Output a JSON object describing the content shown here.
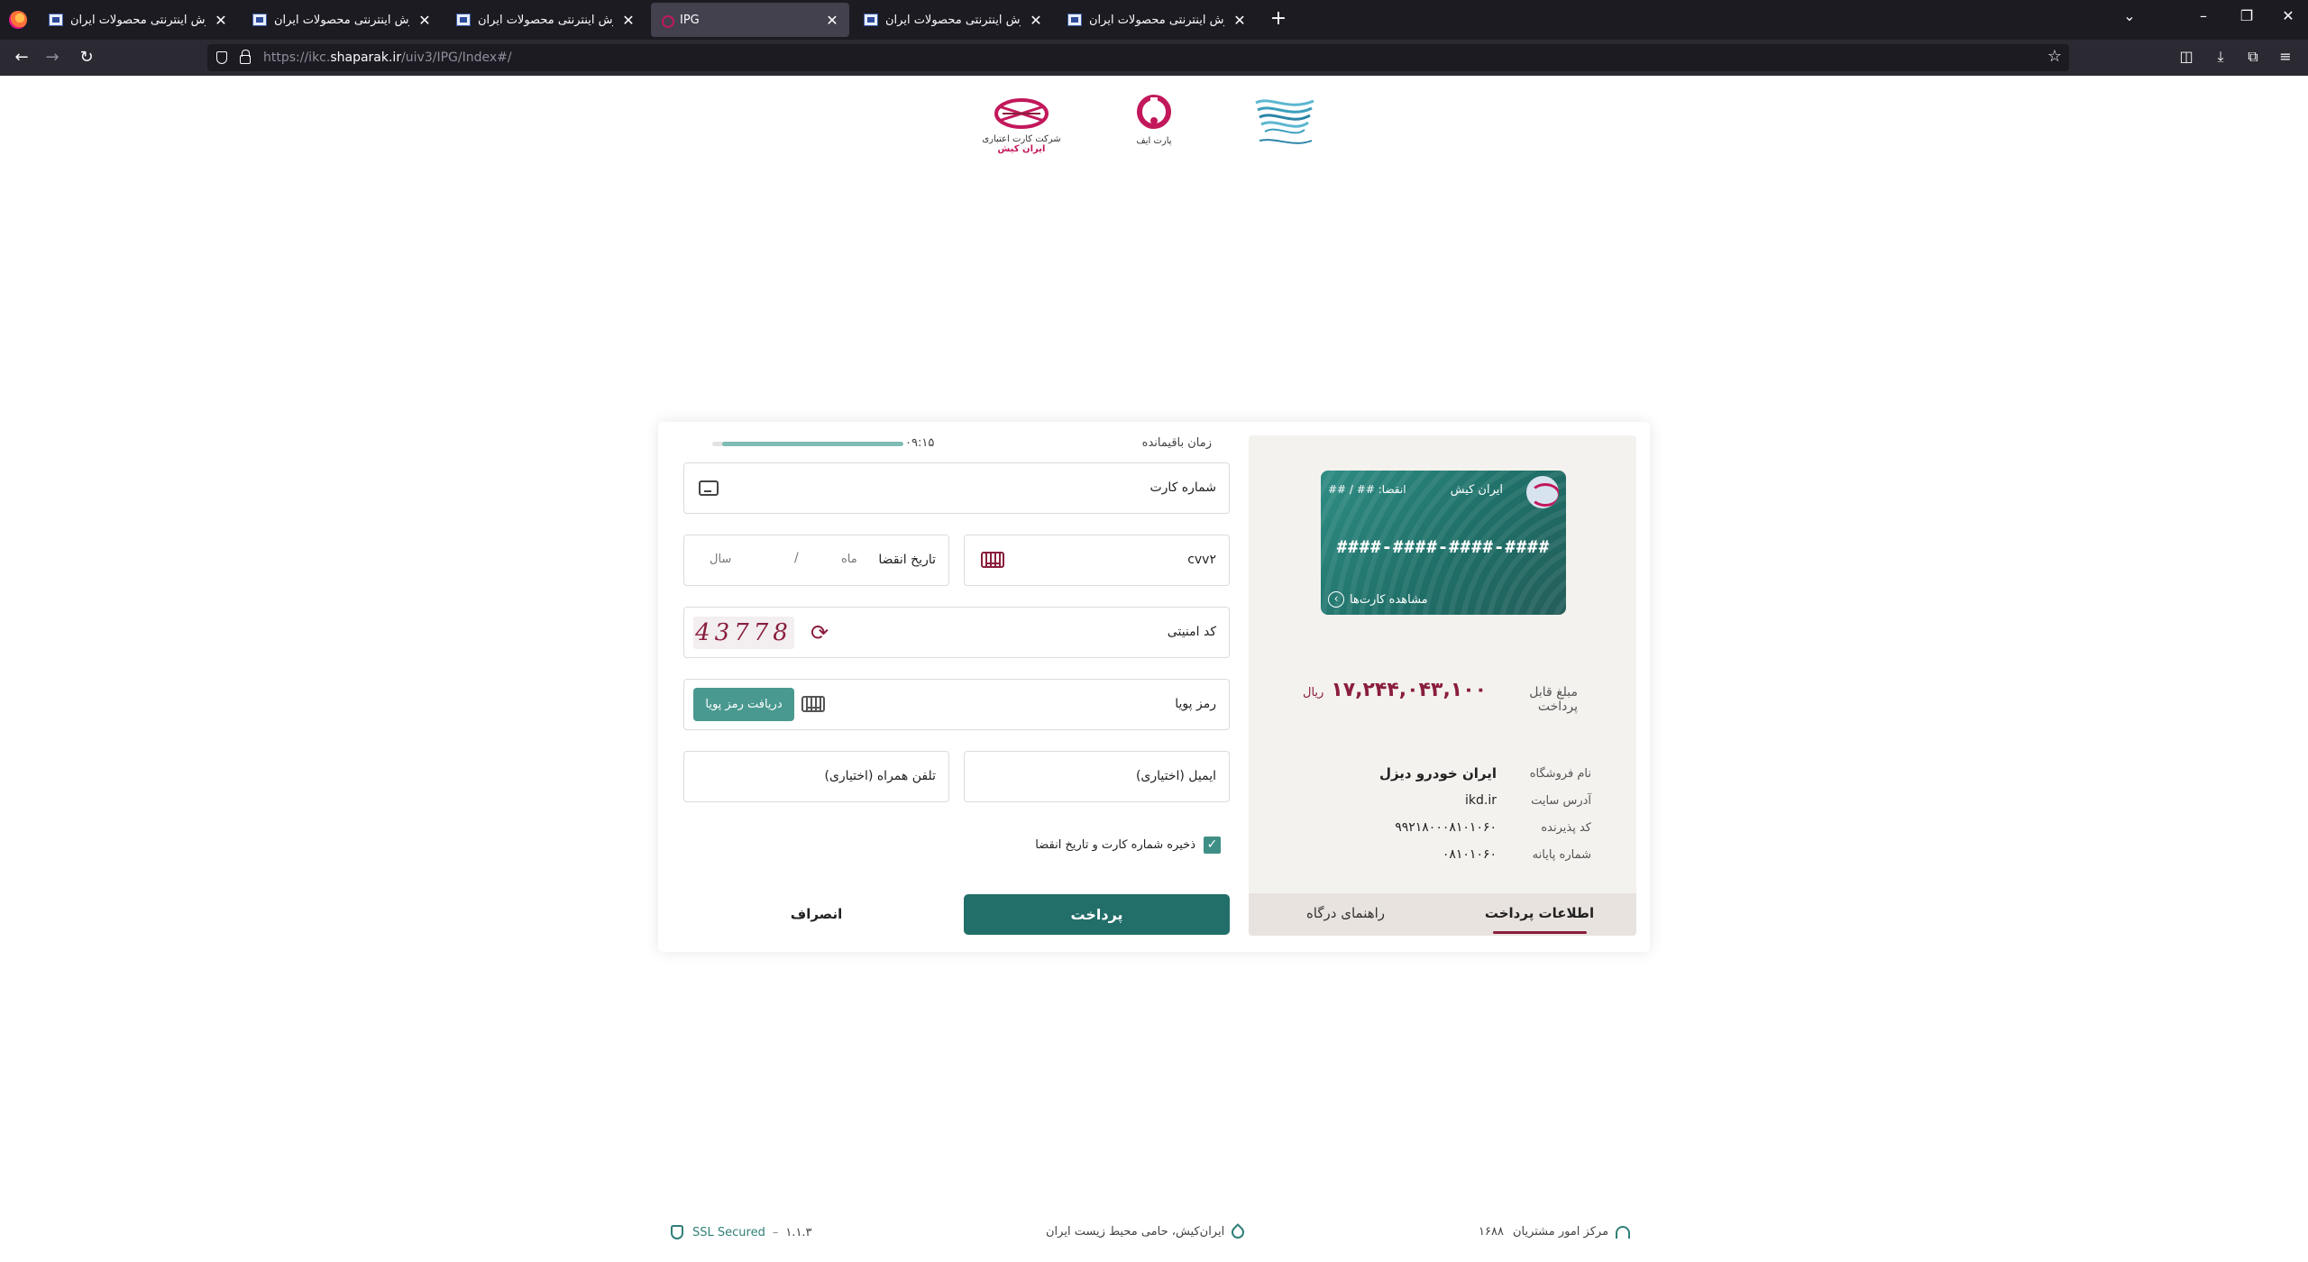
{
  "browser": {
    "tabs": [
      {
        "title": "فروش اینترنتی محصولات ایران -",
        "active": false
      },
      {
        "title": "فروش اینترنتی محصولات ایران -",
        "active": false
      },
      {
        "title": "فروش اینترنتی محصولات ایران -",
        "active": false
      },
      {
        "title": "IPG",
        "active": true
      },
      {
        "title": "فروش اینترنتی محصولات ایران -",
        "active": false
      },
      {
        "title": "فروش اینترنتی محصولات ایران -",
        "active": false
      }
    ],
    "url_prefix": "https://ikc.",
    "url_domain": "shaparak.ir",
    "url_path": "/uiv3/IPG/Index#/"
  },
  "logos": {
    "shaparak": "شاپرک",
    "parsian": "پارت ایف",
    "ikc_line1": "شرکت کارت اعتباری",
    "ikc_line2": "ایران کیش"
  },
  "form": {
    "timer_label": "زمان باقیمانده",
    "timer_value": "۰۹:۱۵",
    "timer_progress": 0.95,
    "card_number_label": "شماره کارت",
    "cvv_label": "cvv۲",
    "expiry_label": "تاریخ انقضا",
    "expiry_month": "ماه",
    "expiry_sep": "/",
    "expiry_year": "سال",
    "captcha_label": "کد امنیتی",
    "captcha_value": "43778",
    "otp_label": "رمز پویا",
    "otp_button": "دریافت رمز پویا",
    "email_label": "ایمیل (اختیاری)",
    "phone_label": "تلفن همراه (اختیاری)",
    "save_label": "ذخیره شماره کارت و تاریخ انقضا",
    "save_checked": true,
    "pay_button": "پرداخت",
    "cancel_button": "انصراف"
  },
  "card": {
    "bank": "ایران کیش",
    "expiry": "انقضا: ## / ##",
    "number": "####-####-####-####",
    "view_cards": "مشاهده کارت‌ها"
  },
  "payment": {
    "amount_label": "مبلغ قابل پرداخت",
    "amount": "۱۷,۲۴۴,۰۴۳,۱۰۰",
    "currency": "ریال"
  },
  "merchant": {
    "name_label": "نام فروشگاه",
    "name": "ایران خودرو دیزل",
    "site_label": "آدرس سایت",
    "site": "ikd.ir",
    "acceptor_label": "کد پذیرنده",
    "acceptor": "۹۹۲۱۸۰۰۰۸۱۰۱۰۶۰",
    "terminal_label": "شماره پایانه",
    "terminal": "۰۸۱۰۱۰۶۰"
  },
  "info_tabs": {
    "payment_info": "اطلاعات پرداخت",
    "gateway_guide": "راهنمای درگاه"
  },
  "footer": {
    "support_label": "مرکز امور مشتریان",
    "support_number": "۱۶۸۸",
    "env": "ایران‌کیش، حامی محیط زیست ایران",
    "ssl": "SSL Secured",
    "version": "۱.۱.۳"
  },
  "colors": {
    "accent": "#226e69",
    "brand": "#8a1e3d"
  }
}
